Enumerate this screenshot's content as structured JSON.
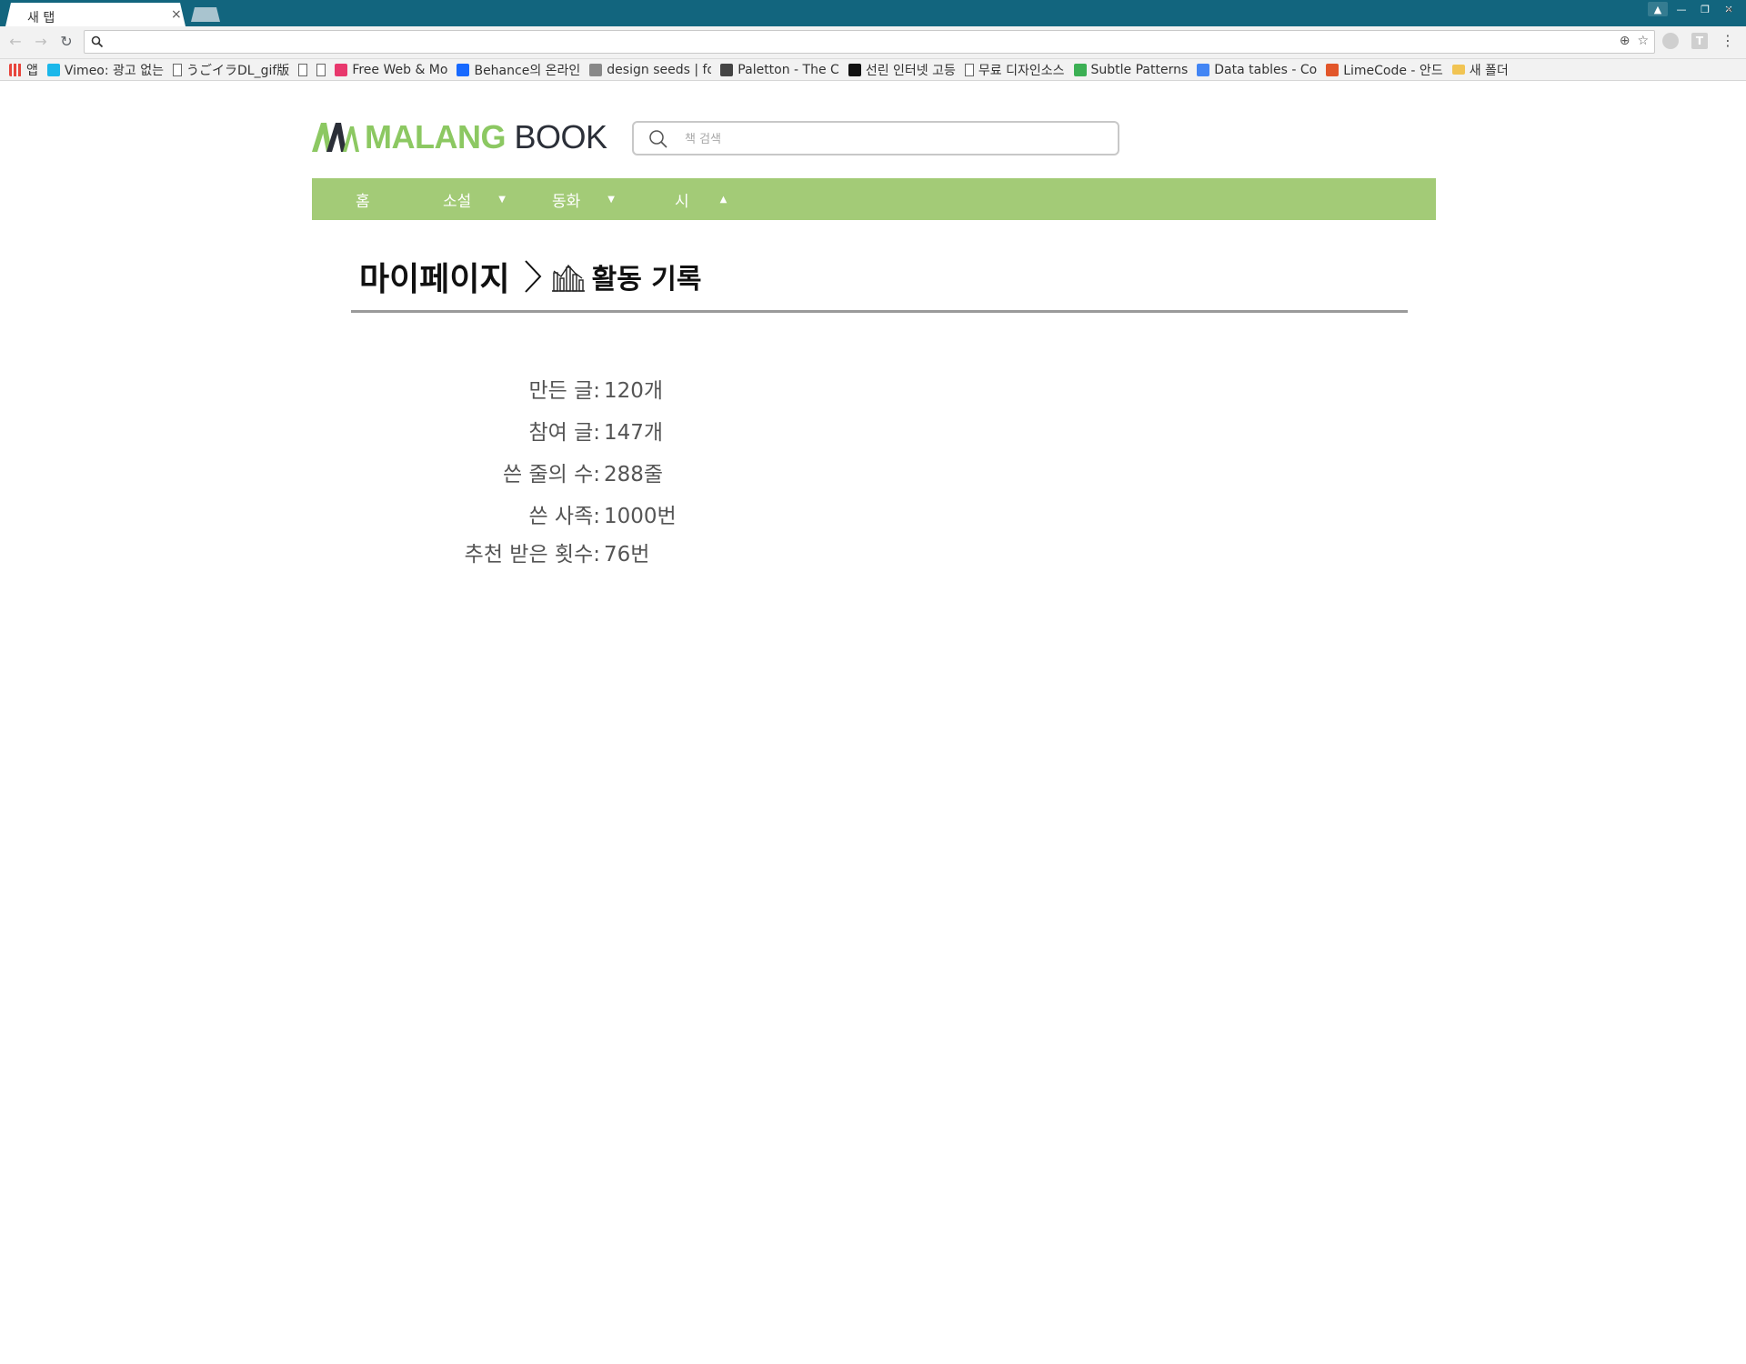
{
  "browser": {
    "tab_title": "새 탭",
    "tab_close": "×",
    "window_controls": [
      "▲",
      "—",
      "❐",
      "✕"
    ],
    "omnibox": {
      "value": "",
      "placeholder": ""
    },
    "ext_t": "T",
    "menu_dots": "⋮",
    "bookmarks_more": "»",
    "bookmarks": [
      {
        "label": "앱",
        "icon": "apps-grid-icon",
        "color": "#e8453c"
      },
      {
        "label": "Vimeo: 광고 없는",
        "icon": "vimeo-icon",
        "color": "#1ab7ea"
      },
      {
        "label": "うごイラDL_gif版",
        "icon": "page-icon",
        "color": ""
      },
      {
        "label": "",
        "icon": "page-icon",
        "color": ""
      },
      {
        "label": "",
        "icon": "page-icon",
        "color": ""
      },
      {
        "label": "Free Web & Mo",
        "icon": "invision-icon",
        "color": "#e8386d"
      },
      {
        "label": "Behance의 온라인",
        "icon": "behance-icon",
        "color": "#1769ff"
      },
      {
        "label": "design seeds | fo",
        "icon": "design-seeds-icon",
        "color": "#888888"
      },
      {
        "label": "Paletton - The C",
        "icon": "paletton-icon",
        "color": "#444444"
      },
      {
        "label": "선린 인터넷 고등",
        "icon": "sunrin-icon",
        "color": "#111111"
      },
      {
        "label": "무료 디자인소스",
        "icon": "page-icon",
        "color": ""
      },
      {
        "label": "Subtle Patterns",
        "icon": "subtle-patterns-icon",
        "color": "#3cb054"
      },
      {
        "label": "Data tables - Co",
        "icon": "google-icon",
        "color": "#4285f4"
      },
      {
        "label": "LimeCode - 안드",
        "icon": "limecode-icon",
        "color": "#e2562a"
      },
      {
        "label": "새 폴더",
        "icon": "folder-icon",
        "color": "#f1c453"
      }
    ]
  },
  "site": {
    "logo_green": "MALANG",
    "logo_dark": "BOOK",
    "search_placeholder": "책 검색",
    "colors": {
      "brand_green": "#a3cb77",
      "logo_green": "#8cc862",
      "logo_dark": "#2b2f38"
    },
    "nav": [
      {
        "label": "홈",
        "arrow": ""
      },
      {
        "label": "소설",
        "arrow": "▼"
      },
      {
        "label": "동화",
        "arrow": "▼"
      },
      {
        "label": "시",
        "arrow": "▲"
      }
    ]
  },
  "page": {
    "breadcrumb_root": "마이페이지",
    "breadcrumb_current": "활동 기록",
    "stats": [
      {
        "label": "만든 글:",
        "value": "120개"
      },
      {
        "label": "참여 글:",
        "value": "147개"
      },
      {
        "label": "쓴 줄의 수:",
        "value": "288줄"
      },
      {
        "label": "쓴 사족:",
        "value": "1000번"
      },
      {
        "label": "추천 받은 횟수:",
        "value": "76번"
      }
    ]
  }
}
